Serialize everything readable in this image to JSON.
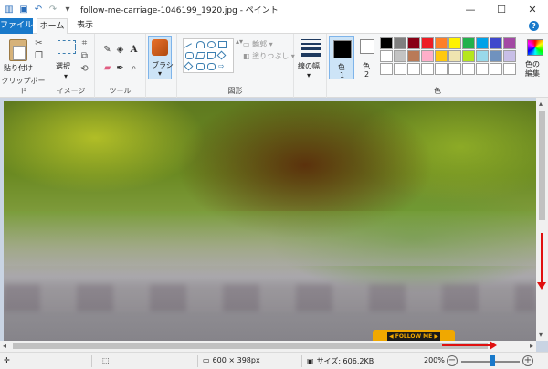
{
  "window": {
    "title": "follow-me-carriage-1046199_1920.jpg - ペイント",
    "controls": {
      "minimize": "—",
      "maximize": "☐",
      "close": "✕"
    }
  },
  "tabs": {
    "file": "ファイル",
    "home": "ホーム",
    "view": "表示"
  },
  "ribbon": {
    "clipboard": {
      "paste": "貼り付け",
      "group": "クリップボード"
    },
    "image": {
      "select": "選択",
      "group": "イメージ"
    },
    "tools": {
      "group": "ツール"
    },
    "brushes": {
      "label": "ブラシ"
    },
    "shapes": {
      "outline": "輪郭",
      "fill": "塗りつぶし",
      "group": "図形"
    },
    "size": {
      "label": "線の幅"
    },
    "colors": {
      "color1": "色",
      "color1_num": "1",
      "color2": "色",
      "color2_num": "2",
      "edit": "色の",
      "edit2": "編集",
      "group": "色",
      "palette_row1": [
        "#000000",
        "#7f7f7f",
        "#880015",
        "#ed1c24",
        "#ff7f27",
        "#fff200",
        "#22b14c",
        "#00a2e8",
        "#3f48cc",
        "#a349a4"
      ],
      "palette_row2": [
        "#ffffff",
        "#c3c3c3",
        "#b97a57",
        "#ffaec9",
        "#ffc90e",
        "#efe4b0",
        "#b5e61d",
        "#99d9ea",
        "#7092be",
        "#c8bfe7"
      ],
      "palette_row3": [
        "#ffffff",
        "#ffffff",
        "#ffffff",
        "#ffffff",
        "#ffffff",
        "#ffffff",
        "#ffffff",
        "#ffffff",
        "#ffffff",
        "#ffffff"
      ]
    }
  },
  "canvas": {
    "sign_text": "◀ FOLLOW ME ▶"
  },
  "status": {
    "dimensions": "600 × 398px",
    "size": "サイズ: 606.2KB",
    "zoom": "200%",
    "zoom_out": "−",
    "zoom_in": "+"
  }
}
